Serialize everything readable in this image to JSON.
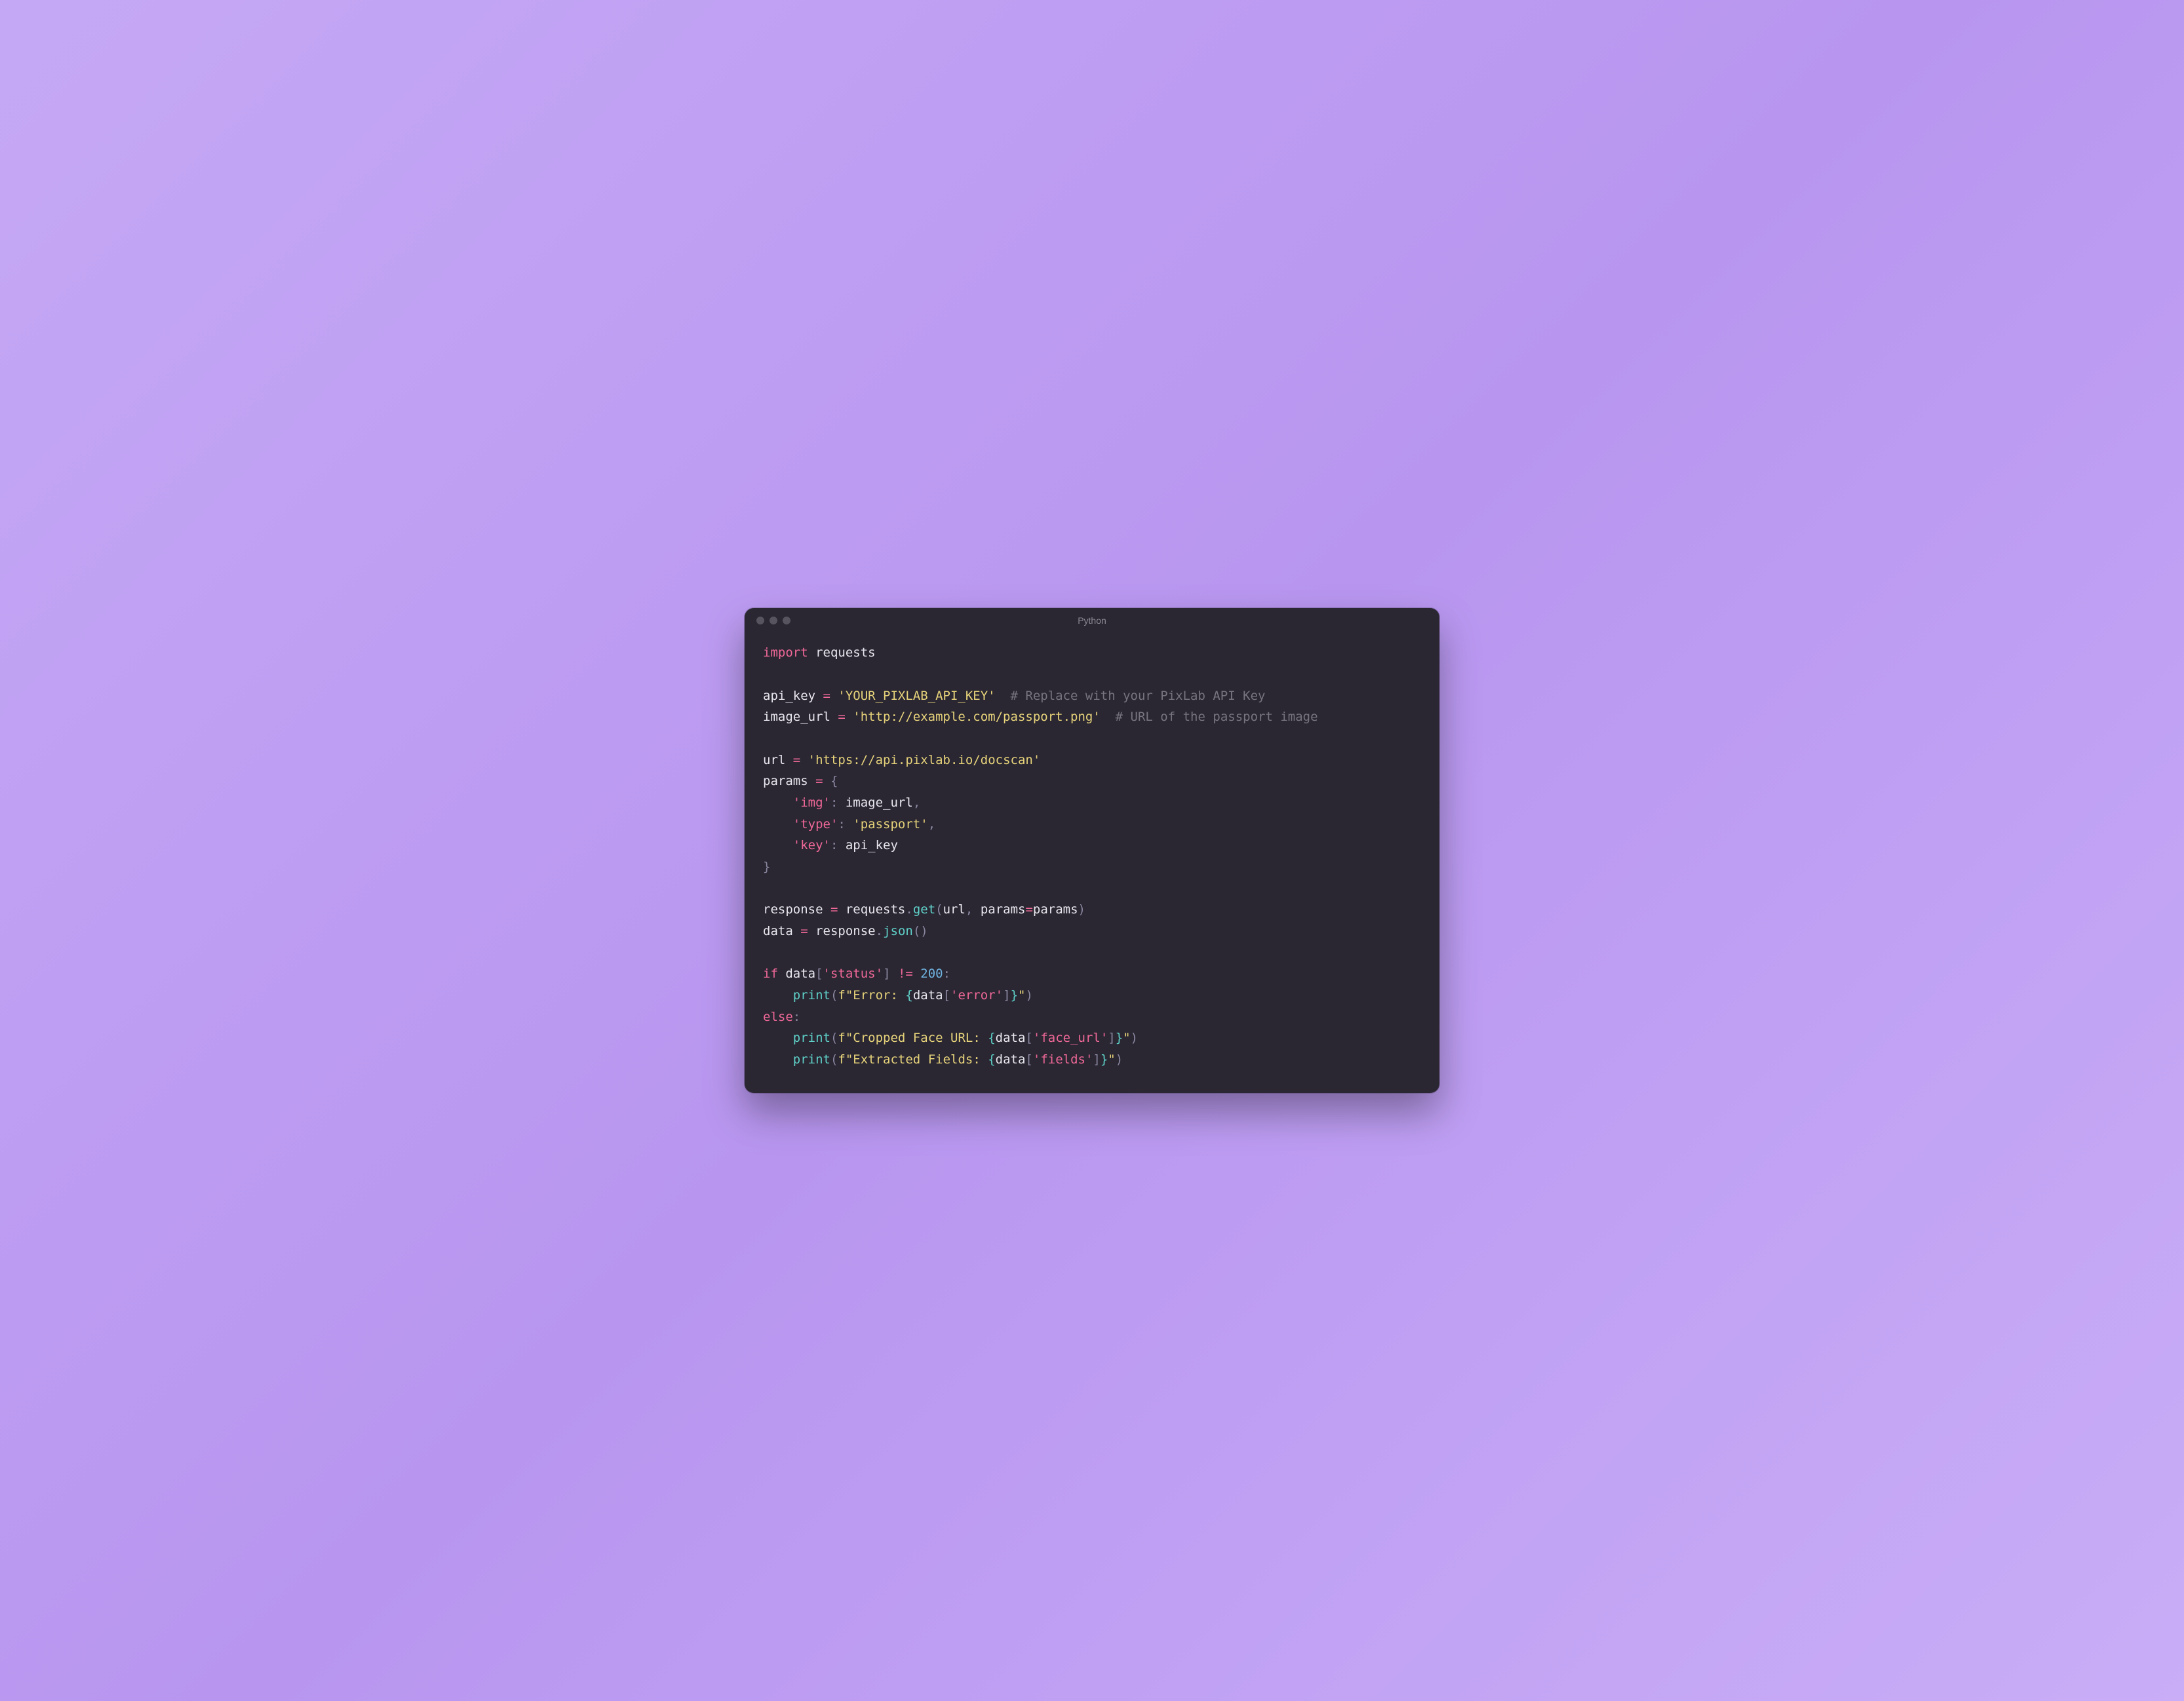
{
  "window": {
    "title": "Python"
  },
  "code": {
    "lines": [
      {
        "tokens": [
          {
            "t": "import ",
            "c": "kw"
          },
          {
            "t": "requests",
            "c": "id"
          }
        ]
      },
      {
        "tokens": []
      },
      {
        "tokens": [
          {
            "t": "api_key ",
            "c": "id"
          },
          {
            "t": "= ",
            "c": "op"
          },
          {
            "t": "'YOUR_PIXLAB_API_KEY'",
            "c": "str"
          },
          {
            "t": "  ",
            "c": "id"
          },
          {
            "t": "# Replace with your PixLab API Key",
            "c": "com"
          }
        ]
      },
      {
        "tokens": [
          {
            "t": "image_url ",
            "c": "id"
          },
          {
            "t": "= ",
            "c": "op"
          },
          {
            "t": "'http://example.com/passport.png'",
            "c": "str"
          },
          {
            "t": "  ",
            "c": "id"
          },
          {
            "t": "# URL of the passport image",
            "c": "com"
          }
        ]
      },
      {
        "tokens": []
      },
      {
        "tokens": [
          {
            "t": "url ",
            "c": "id"
          },
          {
            "t": "= ",
            "c": "op"
          },
          {
            "t": "'https://api.pixlab.io/docscan'",
            "c": "str"
          }
        ]
      },
      {
        "tokens": [
          {
            "t": "params ",
            "c": "id"
          },
          {
            "t": "= ",
            "c": "op"
          },
          {
            "t": "{",
            "c": "pun"
          }
        ]
      },
      {
        "tokens": [
          {
            "t": "    ",
            "c": "id"
          },
          {
            "t": "'img'",
            "c": "str2"
          },
          {
            "t": ": ",
            "c": "pun"
          },
          {
            "t": "image_url",
            "c": "id"
          },
          {
            "t": ",",
            "c": "pun"
          }
        ]
      },
      {
        "tokens": [
          {
            "t": "    ",
            "c": "id"
          },
          {
            "t": "'type'",
            "c": "str2"
          },
          {
            "t": ": ",
            "c": "pun"
          },
          {
            "t": "'passport'",
            "c": "str"
          },
          {
            "t": ",",
            "c": "pun"
          }
        ]
      },
      {
        "tokens": [
          {
            "t": "    ",
            "c": "id"
          },
          {
            "t": "'key'",
            "c": "str2"
          },
          {
            "t": ": ",
            "c": "pun"
          },
          {
            "t": "api_key",
            "c": "id"
          }
        ]
      },
      {
        "tokens": [
          {
            "t": "}",
            "c": "pun"
          }
        ]
      },
      {
        "tokens": []
      },
      {
        "tokens": [
          {
            "t": "response ",
            "c": "id"
          },
          {
            "t": "= ",
            "c": "op"
          },
          {
            "t": "requests",
            "c": "id"
          },
          {
            "t": ".",
            "c": "pun"
          },
          {
            "t": "get",
            "c": "fn"
          },
          {
            "t": "(",
            "c": "pun"
          },
          {
            "t": "url",
            "c": "id"
          },
          {
            "t": ", ",
            "c": "pun"
          },
          {
            "t": "params",
            "c": "id"
          },
          {
            "t": "=",
            "c": "op"
          },
          {
            "t": "params",
            "c": "id"
          },
          {
            "t": ")",
            "c": "pun"
          }
        ]
      },
      {
        "tokens": [
          {
            "t": "data ",
            "c": "id"
          },
          {
            "t": "= ",
            "c": "op"
          },
          {
            "t": "response",
            "c": "id"
          },
          {
            "t": ".",
            "c": "pun"
          },
          {
            "t": "json",
            "c": "fn"
          },
          {
            "t": "()",
            "c": "pun"
          }
        ]
      },
      {
        "tokens": []
      },
      {
        "tokens": [
          {
            "t": "if ",
            "c": "kw"
          },
          {
            "t": "data",
            "c": "id"
          },
          {
            "t": "[",
            "c": "pun"
          },
          {
            "t": "'status'",
            "c": "str2"
          },
          {
            "t": "] ",
            "c": "pun"
          },
          {
            "t": "!= ",
            "c": "op"
          },
          {
            "t": "200",
            "c": "num"
          },
          {
            "t": ":",
            "c": "pun"
          }
        ]
      },
      {
        "tokens": [
          {
            "t": "    ",
            "c": "id"
          },
          {
            "t": "print",
            "c": "fn"
          },
          {
            "t": "(",
            "c": "pun"
          },
          {
            "t": "f\"Error: ",
            "c": "str"
          },
          {
            "t": "{",
            "c": "fstr"
          },
          {
            "t": "data",
            "c": "id"
          },
          {
            "t": "[",
            "c": "pun"
          },
          {
            "t": "'error'",
            "c": "str2"
          },
          {
            "t": "]",
            "c": "pun"
          },
          {
            "t": "}",
            "c": "fstr"
          },
          {
            "t": "\"",
            "c": "str"
          },
          {
            "t": ")",
            "c": "pun"
          }
        ]
      },
      {
        "tokens": [
          {
            "t": "else",
            "c": "kw"
          },
          {
            "t": ":",
            "c": "pun"
          }
        ]
      },
      {
        "tokens": [
          {
            "t": "    ",
            "c": "id"
          },
          {
            "t": "print",
            "c": "fn"
          },
          {
            "t": "(",
            "c": "pun"
          },
          {
            "t": "f\"Cropped Face URL: ",
            "c": "str"
          },
          {
            "t": "{",
            "c": "fstr"
          },
          {
            "t": "data",
            "c": "id"
          },
          {
            "t": "[",
            "c": "pun"
          },
          {
            "t": "'face_url'",
            "c": "str2"
          },
          {
            "t": "]",
            "c": "pun"
          },
          {
            "t": "}",
            "c": "fstr"
          },
          {
            "t": "\"",
            "c": "str"
          },
          {
            "t": ")",
            "c": "pun"
          }
        ]
      },
      {
        "tokens": [
          {
            "t": "    ",
            "c": "id"
          },
          {
            "t": "print",
            "c": "fn"
          },
          {
            "t": "(",
            "c": "pun"
          },
          {
            "t": "f\"Extracted Fields: ",
            "c": "str"
          },
          {
            "t": "{",
            "c": "fstr"
          },
          {
            "t": "data",
            "c": "id"
          },
          {
            "t": "[",
            "c": "pun"
          },
          {
            "t": "'fields'",
            "c": "str2"
          },
          {
            "t": "]",
            "c": "pun"
          },
          {
            "t": "}",
            "c": "fstr"
          },
          {
            "t": "\"",
            "c": "str"
          },
          {
            "t": ")",
            "c": "pun"
          }
        ]
      }
    ]
  }
}
